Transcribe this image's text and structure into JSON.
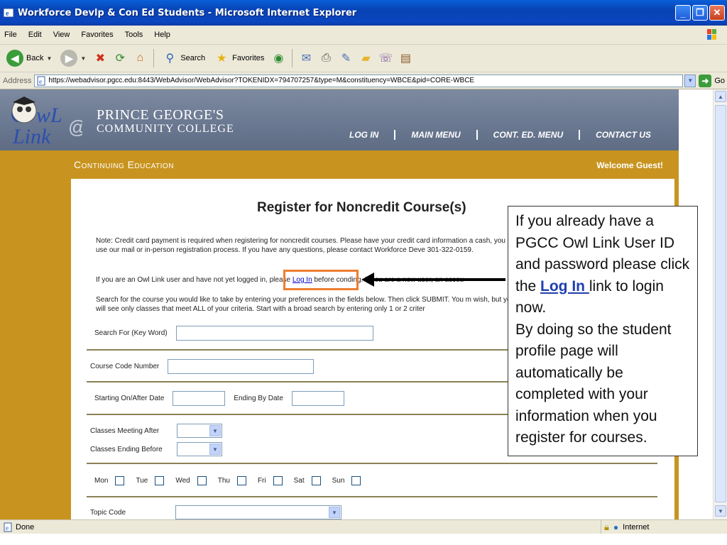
{
  "window": {
    "title": "Workforce Devlp & Con Ed Students - Microsoft Internet Explorer",
    "minimize": "_",
    "restore": "❐",
    "close": "✕"
  },
  "menu": [
    "File",
    "Edit",
    "View",
    "Favorites",
    "Tools",
    "Help"
  ],
  "toolbar": {
    "back": "Back",
    "search": "Search",
    "favorites": "Favorites"
  },
  "address": {
    "label": "Address",
    "url": "https://webadvisor.pgcc.edu:8443/WebAdvisor/WebAdvisor?TOKENIDX=794707257&type=M&constituency=WBCE&pid=CORE-WBCE",
    "go": "Go"
  },
  "site": {
    "college_line1": "PRINCE GEORGE'S",
    "college_line2": "COMMUNITY COLLEGE",
    "nav": [
      "Log In",
      "Main Menu",
      "Cont. Ed. Menu",
      "Contact Us"
    ],
    "section": "Continuing Education",
    "welcome": "Welcome Guest!"
  },
  "content": {
    "heading": "Register for Noncredit Course(s)",
    "note": "Note: Credit card payment is required when registering for noncredit courses. Please have your credit card information a cash, you may use our mail or in-person registration process. If you have any questions, please contact Workforce Deve 301-322-0159.",
    "owl_pre": "If you are an Owl Link user and have not yet logged in, please",
    "owl_link": "Log In",
    "owl_post": "before co",
    "owl_hidden": "nding. If you are a new user, an accou",
    "search_note": "Search for the course you would like to take by entering your preferences in the fields below. Then click SUBMIT. You m wish, but you will see only classes that meet ALL of your criteria. Start with a broad search by entering only 1 or 2 criter",
    "search_for_label": "Search For (Key Word)",
    "course_code_label": "Course Code Number",
    "start_date_label": "Starting On/After Date",
    "end_date_label": "Ending By Date",
    "meeting_after_label": "Classes Meeting After",
    "ending_before_label": "Classes Ending Before",
    "days": [
      "Mon",
      "Tue",
      "Wed",
      "Thu",
      "Fri",
      "Sat",
      "Sun"
    ],
    "topic_code_label": "Topic Code"
  },
  "callout": {
    "pre": "If you already have a PGCC Owl Link  User ID and password please click the ",
    "link": "Log In ",
    "post": "link to login now.",
    "line2": "By doing so the student profile page will automatically be completed with your information when you register for courses."
  },
  "status": {
    "left": "Done",
    "zone": "Internet"
  }
}
